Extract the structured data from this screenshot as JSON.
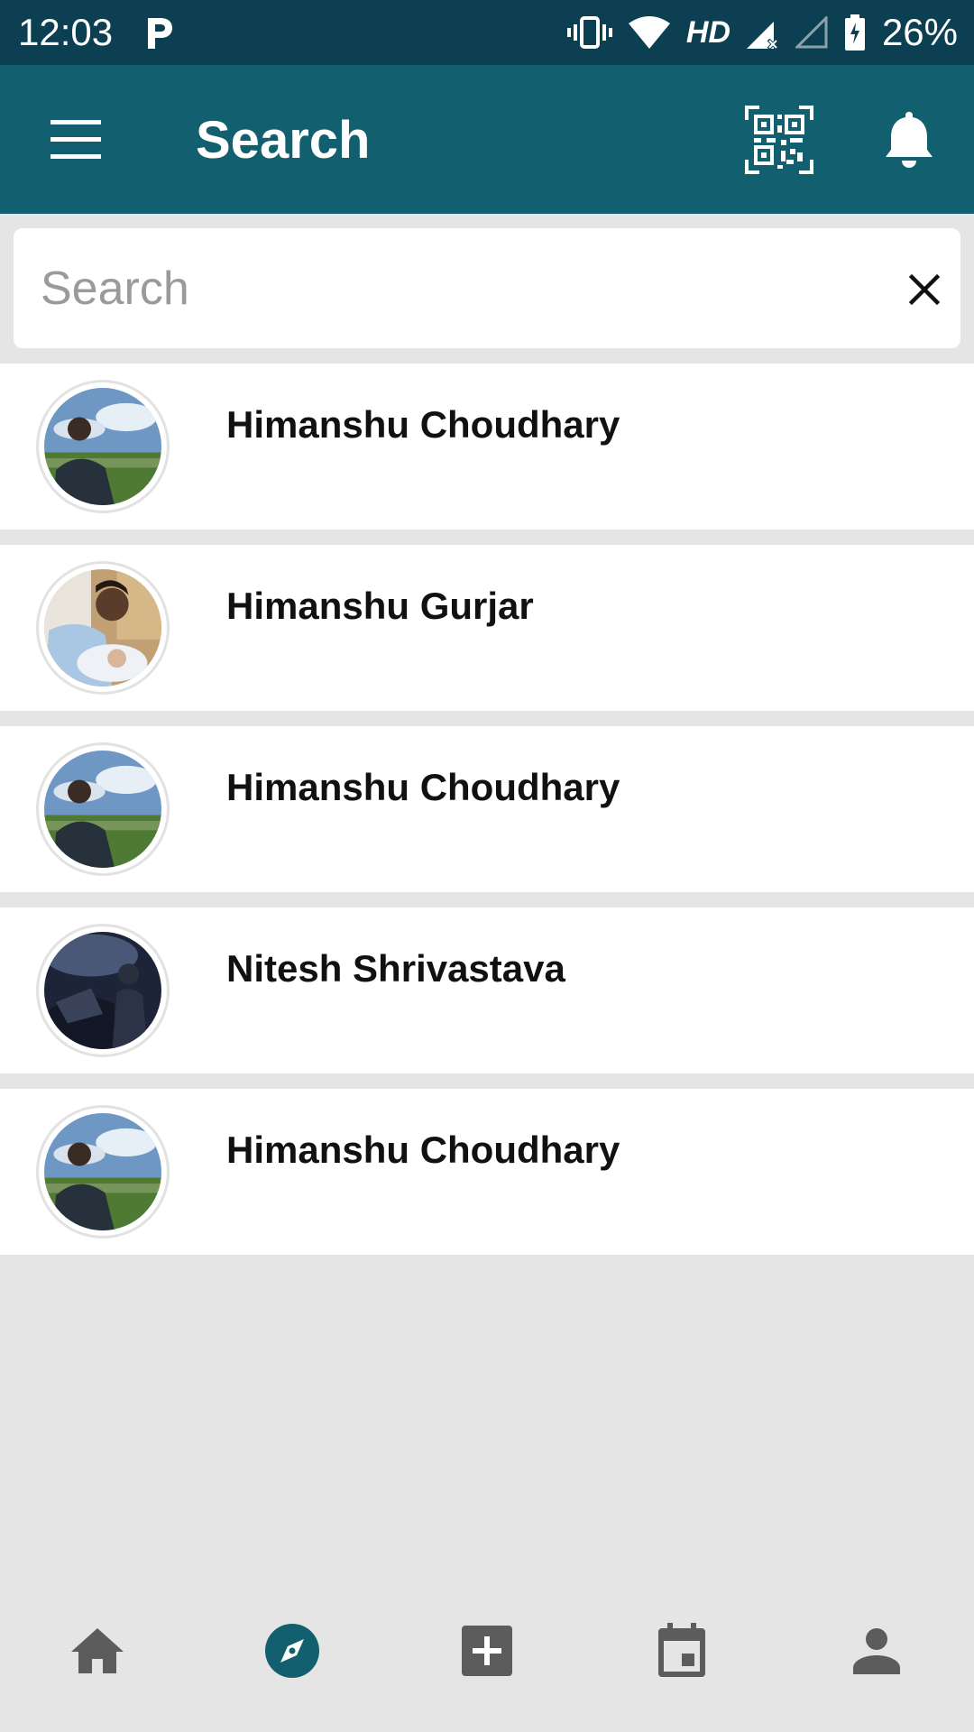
{
  "status_bar": {
    "time": "12:03",
    "network_label": "HD",
    "battery": "26%",
    "icons": [
      "parking-icon",
      "vibrate-icon",
      "wifi-icon",
      "signal-icon",
      "signal-empty-icon",
      "battery-icon"
    ]
  },
  "app_bar": {
    "title": "Search",
    "icons": [
      "menu-icon",
      "qr-code-icon",
      "bell-icon"
    ],
    "color": "#12606f"
  },
  "search": {
    "value": "",
    "placeholder": "Search",
    "clear_icon": "close-icon"
  },
  "results": [
    {
      "name": "Himanshu Choudhary",
      "avatar": "avatar-photo"
    },
    {
      "name": "Himanshu Gurjar",
      "avatar": "avatar-photo"
    },
    {
      "name": "Himanshu Choudhary",
      "avatar": "avatar-photo"
    },
    {
      "name": "Nitesh Shrivastava",
      "avatar": "avatar-photo"
    },
    {
      "name": "Himanshu Choudhary",
      "avatar": "avatar-photo"
    }
  ],
  "bottom_nav": {
    "items": [
      "home-icon",
      "explore-icon",
      "add-icon",
      "calendar-icon",
      "profile-icon"
    ],
    "active": "explore-icon",
    "active_color": "#12606f",
    "inactive_color": "#5c5c5c"
  }
}
